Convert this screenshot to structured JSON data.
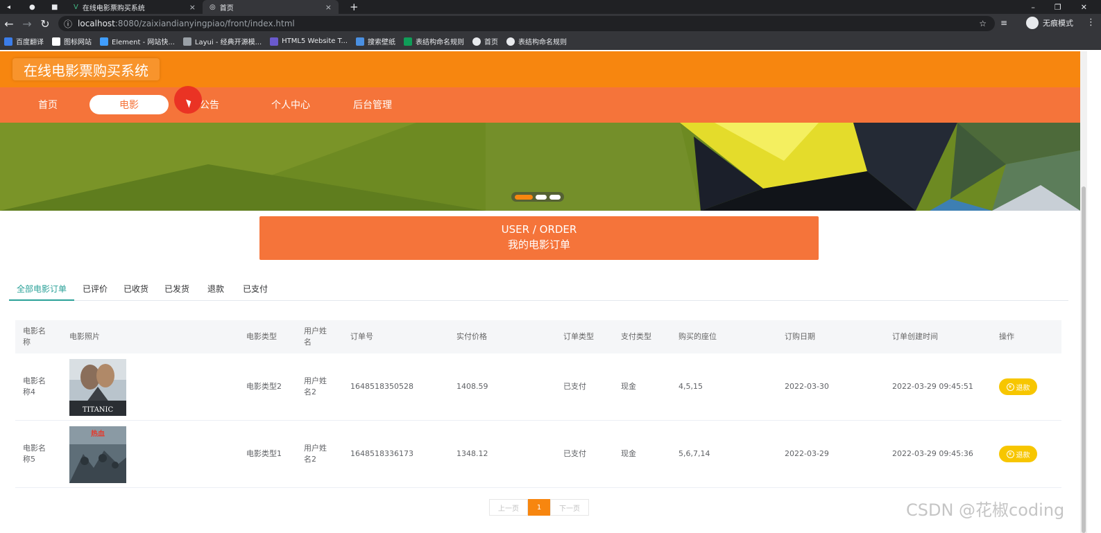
{
  "browser": {
    "tabs": [
      {
        "label": "在线电影票购买系统",
        "active": false
      },
      {
        "label": "首页",
        "active": true
      }
    ],
    "url_host": "localhost",
    "url_path": ":8080/zaixiandianyingpiao/front/index.html",
    "incognito_label": "无痕模式",
    "bookmarks": [
      "百度翻译",
      "图标网站",
      "Element - 网站快...",
      "Layui - 经典开源模...",
      "HTML5 Website T...",
      "搜索壁纸",
      "表结构命名规则",
      "首页",
      "表结构命名规则"
    ]
  },
  "site": {
    "title": "在线电影票购买系统",
    "nav": [
      {
        "label": "首页",
        "active": false
      },
      {
        "label": "电影",
        "active": true
      },
      {
        "label": "公告",
        "active": false
      },
      {
        "label": "个人中心",
        "active": false
      },
      {
        "label": "后台管理",
        "active": false
      }
    ]
  },
  "section": {
    "title_en": "USER / ORDER",
    "title_zh": "我的电影订单"
  },
  "order_tabs": [
    {
      "label": "全部电影订单",
      "active": true
    },
    {
      "label": "已评价",
      "active": false
    },
    {
      "label": "已收货",
      "active": false
    },
    {
      "label": "已发货",
      "active": false
    },
    {
      "label": "退款",
      "active": false
    },
    {
      "label": "已支付",
      "active": false
    }
  ],
  "table": {
    "headers": [
      "电影名称",
      "电影照片",
      "电影类型",
      "用户姓名",
      "订单号",
      "实付价格",
      "订单类型",
      "支付类型",
      "购买的座位",
      "订购日期",
      "订单创建时间",
      "操作"
    ],
    "rows": [
      {
        "name": "电影名称4",
        "poster": "TITANIC",
        "type": "电影类型2",
        "user": "用户姓名2",
        "order_no": "1648518350528",
        "price": "1408.59",
        "order_type": "已支付",
        "pay_type": "现金",
        "seats": "4,5,15",
        "date": "2022-03-30",
        "created": "2022-03-29 09:45:51",
        "action": "退款"
      },
      {
        "name": "电影名称5",
        "poster": "热血",
        "type": "电影类型1",
        "user": "用户姓名2",
        "order_no": "1648518336173",
        "price": "1348.12",
        "order_type": "已支付",
        "pay_type": "现金",
        "seats": "5,6,7,14",
        "date": "2022-03-29",
        "created": "2022-03-29 09:45:36",
        "action": "退款"
      }
    ]
  },
  "pagination": {
    "prev": "上一页",
    "current": "1",
    "next": "下一页"
  },
  "watermark": "CSDN @花椒coding",
  "colors": {
    "header": "#f7860f",
    "nav": "#f5743a",
    "accent_tab": "#2aa198",
    "refund": "#f7c600"
  }
}
